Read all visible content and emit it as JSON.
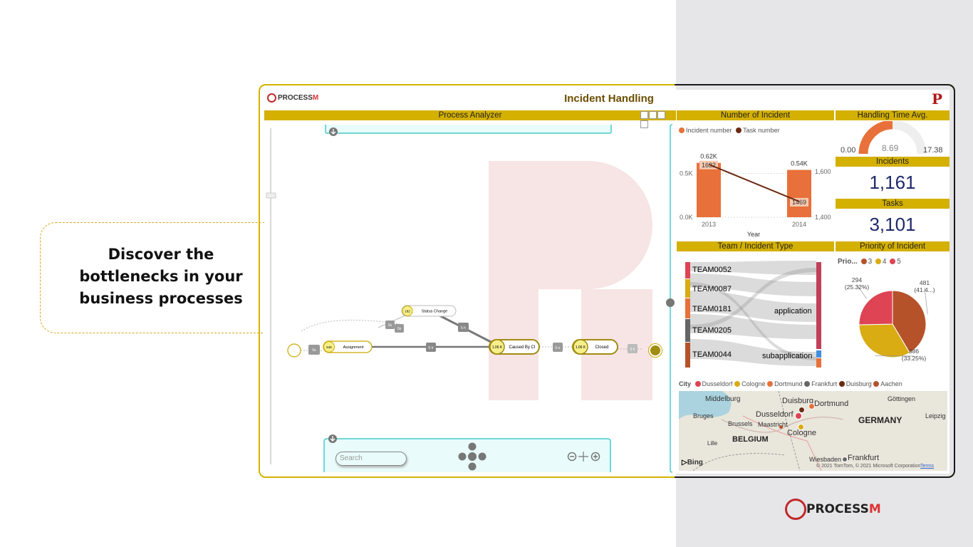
{
  "callout": {
    "line1": "Discover the",
    "line2": "bottlenecks in your",
    "line3": "business processes"
  },
  "dashboard": {
    "title": "Incident Handling",
    "logo_text": "PROCESS",
    "logo_suffix": "M",
    "badge": "P"
  },
  "process_analyzer": {
    "header": "Process Analyzer",
    "search_placeholder": "Search",
    "nodes": {
      "assignment": {
        "count": "546",
        "label": "Assignment"
      },
      "status_change": {
        "count": "182",
        "label": "Status Change"
      },
      "caused_by_ci": {
        "count": "1.06 K",
        "label": "Caused By CI"
      },
      "closed": {
        "count": "1.06 K",
        "label": "Closed"
      }
    },
    "edges": {
      "e1": "0s",
      "e2": "0s",
      "e3": "0s",
      "e4": "5 h",
      "e5": "5 h",
      "e6": "0 s",
      "e7": "0 h"
    }
  },
  "number_of_incident": {
    "header": "Number of Incident",
    "legend": [
      {
        "label": "Incident number",
        "color": "#e8703a"
      },
      {
        "label": "Task number",
        "color": "#6b2a12"
      }
    ],
    "xlabel": "Year"
  },
  "chart_data": [
    {
      "type": "bar",
      "title": "Number of Incident",
      "categories": [
        "2013",
        "2014"
      ],
      "series": [
        {
          "name": "Incident number",
          "values": [
            620,
            540
          ],
          "labels": [
            "0.62K",
            "0.54K"
          ]
        },
        {
          "name": "Task number",
          "values": [
            1632,
            1469
          ],
          "labels": [
            "1632",
            "1469"
          ]
        }
      ],
      "xlabel": "Year",
      "left_ticks": [
        "0.5K",
        "0.0K"
      ],
      "right_ticks": [
        "1,600",
        "1,400"
      ],
      "ylim_left": [
        0,
        650
      ],
      "ylim_right": [
        1400,
        1650
      ]
    },
    {
      "type": "pie",
      "title": "Priority of Incident",
      "legend_title": "Prio...",
      "slices": [
        {
          "name": "3",
          "value": 481,
          "label": "481",
          "pct": "(41.4...)",
          "color": "#b5522a"
        },
        {
          "name": "4",
          "value": 386,
          "label": "386",
          "pct": "(33.25%)",
          "color": "#d8ac12"
        },
        {
          "name": "5",
          "value": 294,
          "label": "294",
          "pct": "(25.32%)",
          "color": "#de4454"
        }
      ]
    }
  ],
  "handling_time": {
    "header": "Handling Time Avg.",
    "min": "0.00",
    "value": "8.69",
    "max": "17.38",
    "fraction": 0.5
  },
  "incidents": {
    "header": "Incidents",
    "value": "1,161"
  },
  "tasks": {
    "header": "Tasks",
    "value": "3,101"
  },
  "team_incident": {
    "header": "Team / Incident Type",
    "teams": [
      "TEAM0052",
      "TEAM0087",
      "TEAM0181",
      "TEAM0205",
      "TEAM0044"
    ],
    "types": [
      "application",
      "subapplication"
    ]
  },
  "priority": {
    "header": "Priority of Incident",
    "legend_title": "Prio...",
    "legend": [
      {
        "label": "3",
        "color": "#b5522a"
      },
      {
        "label": "4",
        "color": "#d8ac12"
      },
      {
        "label": "5",
        "color": "#de4454"
      }
    ]
  },
  "city": {
    "title": "City",
    "legend": [
      {
        "label": "Dusseldorf",
        "color": "#de4454"
      },
      {
        "label": "Cologne",
        "color": "#d8ac12"
      },
      {
        "label": "Dortmund",
        "color": "#e8703a"
      },
      {
        "label": "Frankfurt",
        "color": "#666666"
      },
      {
        "label": "Duisburg",
        "color": "#6b2a12"
      },
      {
        "label": "Aachen",
        "color": "#b5522a"
      }
    ],
    "map_labels": {
      "middelburg": "Middelburg",
      "duisburg": "Duisburg",
      "dortmund": "Dortmund",
      "gottingen": "Göttingen",
      "bruges": "Bruges",
      "dusseldorf": "Dusseldorf",
      "leipzig": "Leipzig",
      "brussels": "Brussels",
      "maastricht": "Maastricht",
      "germany": "GERMANY",
      "cologne": "Cologne",
      "belgium": "BELGIUM",
      "lille": "Lille",
      "wiesbaden": "Wiesbaden",
      "frankfurt": "Frankfurt",
      "bing": "Bing",
      "copyright": "© 2021 TomTom, © 2021 Microsoft Corporation",
      "terms": "Terms"
    }
  },
  "footer_logo": {
    "text": "PROCESS",
    "suffix": "M"
  }
}
